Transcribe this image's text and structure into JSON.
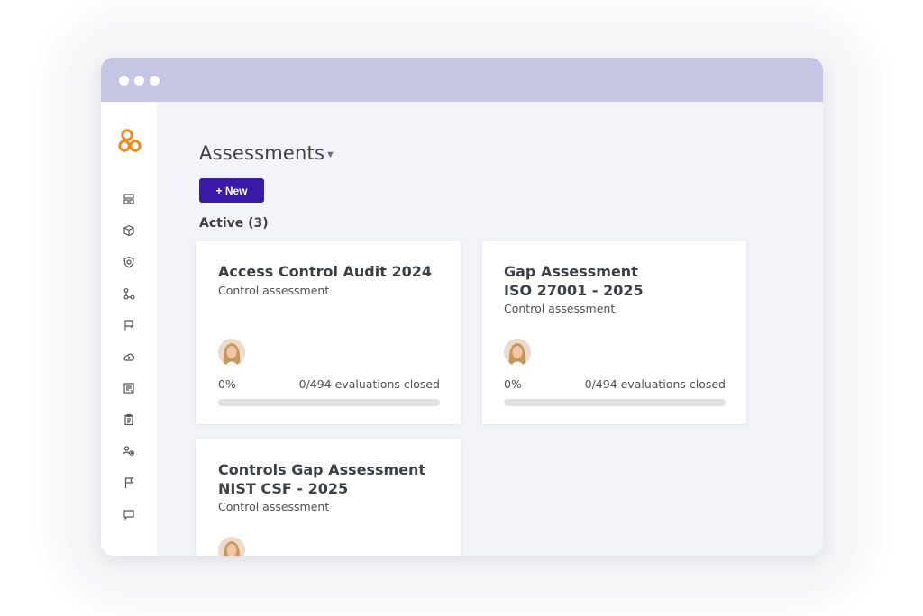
{
  "app": {
    "logo_icon": "orange-circles-logo",
    "accent_color": "#3a1aa8",
    "logo_color": "#f28a1a",
    "titlebar_color": "#c5c6e3"
  },
  "sidebar": {
    "items": [
      {
        "icon": "dashboard-icon"
      },
      {
        "icon": "cube-icon"
      },
      {
        "icon": "shield-icon"
      },
      {
        "icon": "workflow-icon"
      },
      {
        "icon": "flag-edit-icon"
      },
      {
        "icon": "cloud-upload-icon"
      },
      {
        "icon": "report-icon"
      },
      {
        "icon": "clipboard-icon"
      },
      {
        "icon": "settings-users-icon"
      },
      {
        "icon": "flag-icon"
      },
      {
        "icon": "chat-icon"
      }
    ]
  },
  "main": {
    "title": "Assessments",
    "title_caret": "▼",
    "new_button_label": "+ New",
    "section_label": "Active (3)",
    "cards": [
      {
        "title_lines": [
          "Access Control Audit 2024"
        ],
        "subtitle": "Control assessment",
        "progress_text": "0%",
        "progress": 0,
        "evaluations": "0/494 evaluations closed"
      },
      {
        "title_lines": [
          "Gap Assessment",
          "ISO 27001 - 2025"
        ],
        "subtitle": "Control assessment",
        "progress_text": "0%",
        "progress": 0,
        "evaluations": "0/494 evaluations closed"
      },
      {
        "title_lines": [
          "Controls Gap Assessment",
          "NIST CSF - 2025"
        ],
        "subtitle": "Control assessment"
      }
    ]
  }
}
